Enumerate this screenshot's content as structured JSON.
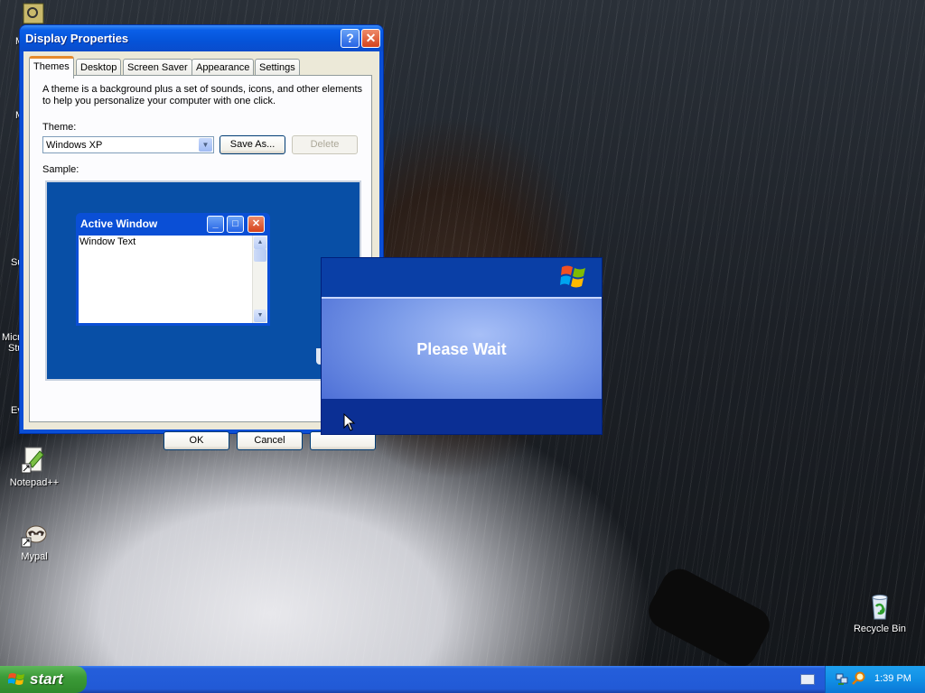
{
  "desktop": {
    "icons": [
      {
        "name": "Notepad++"
      },
      {
        "name": "Mypal"
      },
      {
        "name": "Recycle Bin"
      }
    ],
    "partial_labels": [
      "M",
      "M",
      "Su",
      "Micro",
      "Stu",
      "Ev"
    ]
  },
  "display_properties": {
    "title": "Display Properties",
    "help_icon": "?",
    "close_icon": "✕",
    "tabs": [
      {
        "label": "Themes",
        "active": true
      },
      {
        "label": "Desktop"
      },
      {
        "label": "Screen Saver"
      },
      {
        "label": "Appearance"
      },
      {
        "label": "Settings"
      }
    ],
    "description": "A theme is a background plus a set of sounds, icons, and other elements to help you personalize your computer with one click.",
    "theme_label": "Theme:",
    "theme_value": "Windows XP",
    "save_as_label": "Save As...",
    "delete_label": "Delete",
    "sample_label": "Sample:",
    "sample_window": {
      "title": "Active Window",
      "text": "Window Text"
    },
    "ok_label": "OK",
    "cancel_label": "Cancel"
  },
  "please_wait": {
    "text": "Please Wait"
  },
  "taskbar": {
    "start_label": "start",
    "clock": "1:39 PM"
  },
  "colors": {
    "xp_blue": "#0a4fd6",
    "start_green": "#3c9b38",
    "tray_blue": "#1190e6"
  }
}
